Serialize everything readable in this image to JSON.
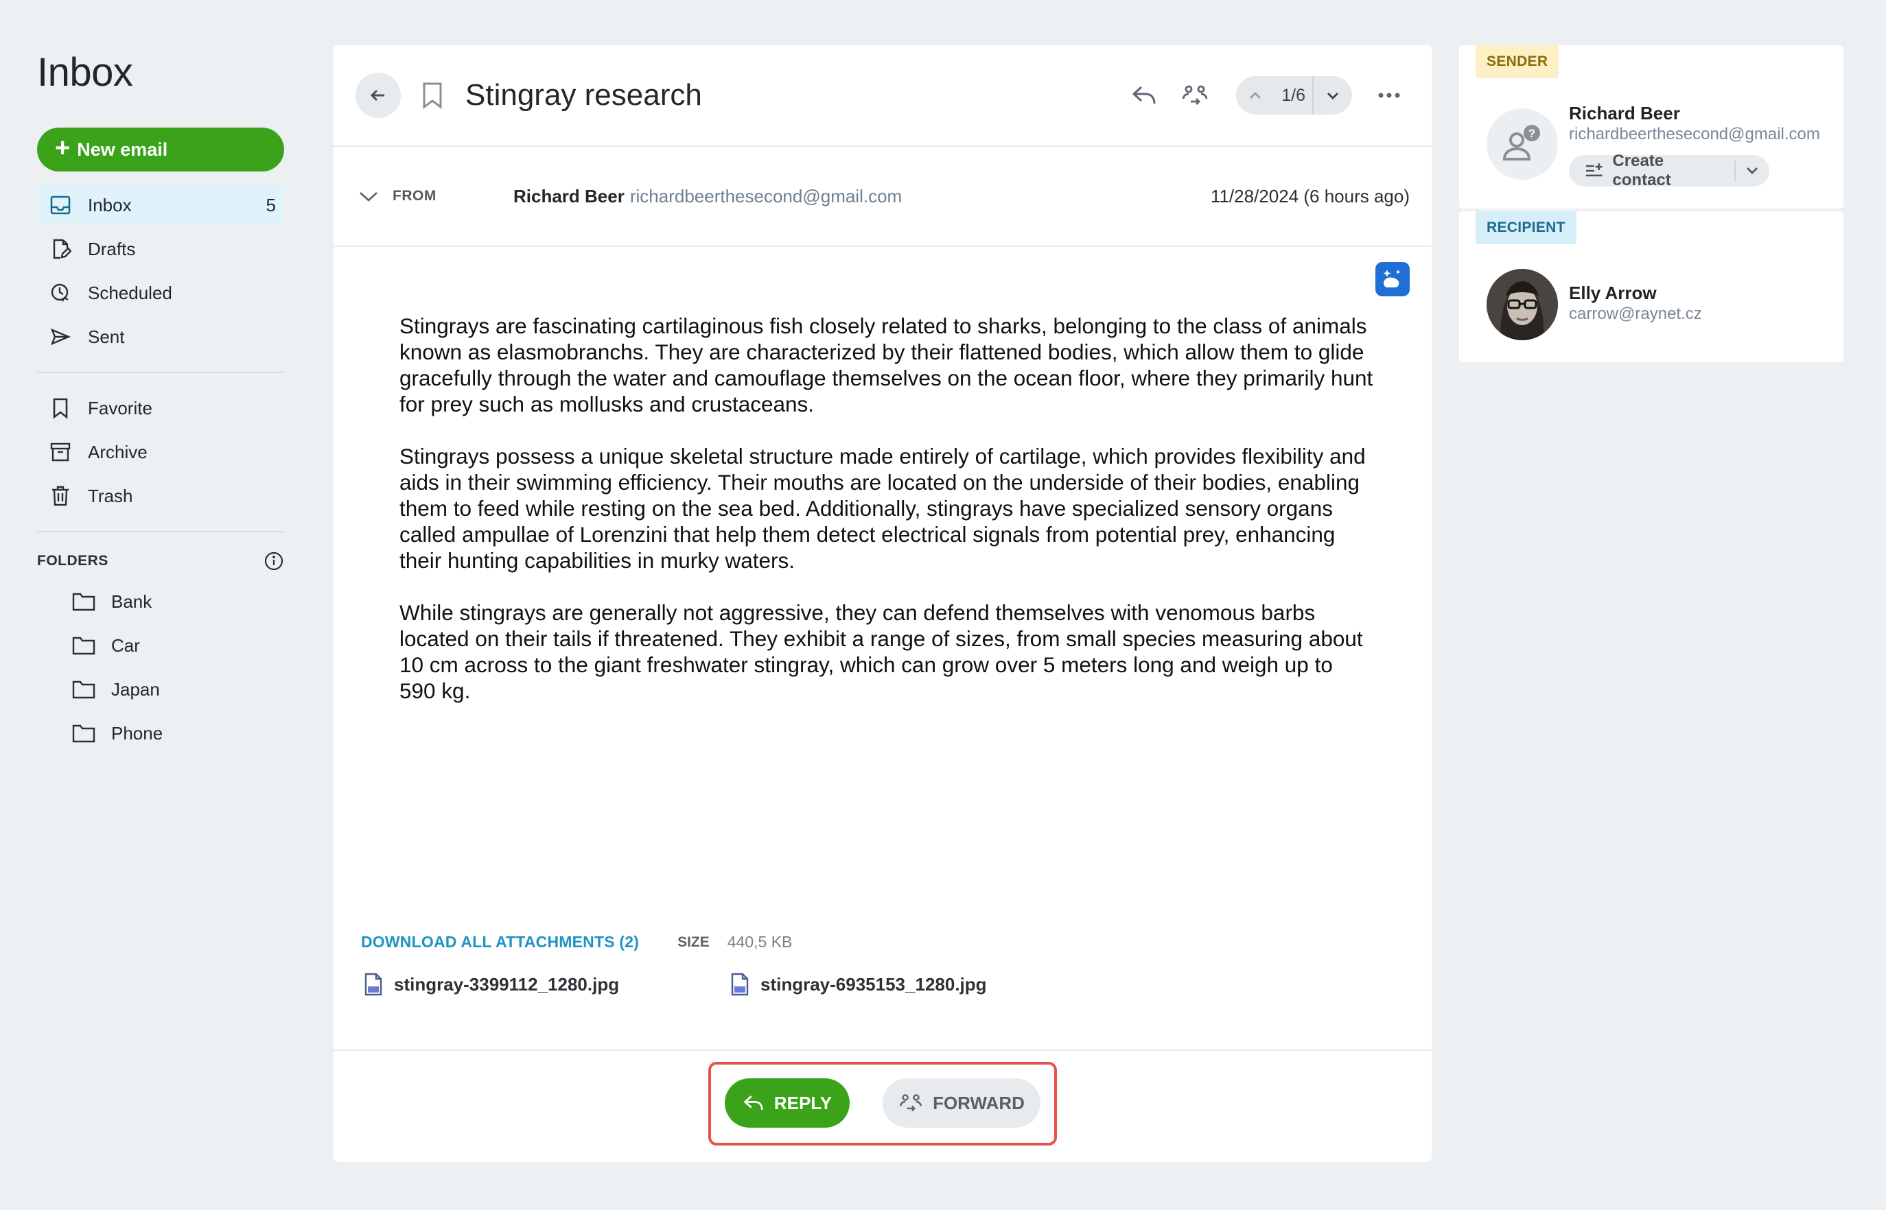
{
  "sidebar": {
    "title": "Inbox",
    "new_email_label": "New email",
    "items": [
      {
        "label": "Inbox",
        "count": "5",
        "icon": "inbox-icon"
      },
      {
        "label": "Drafts",
        "icon": "drafts-icon"
      },
      {
        "label": "Scheduled",
        "icon": "scheduled-icon"
      },
      {
        "label": "Sent",
        "icon": "sent-icon"
      }
    ],
    "items2": [
      {
        "label": "Favorite",
        "icon": "bookmark-icon"
      },
      {
        "label": "Archive",
        "icon": "archive-icon"
      },
      {
        "label": "Trash",
        "icon": "trash-icon"
      }
    ],
    "folders_heading": "FOLDERS",
    "folders": [
      {
        "label": "Bank"
      },
      {
        "label": "Car"
      },
      {
        "label": "Japan"
      },
      {
        "label": "Phone"
      }
    ]
  },
  "email": {
    "subject": "Stingray research",
    "pager": "1/6",
    "from_label": "FROM",
    "from_name": "Richard Beer",
    "from_email": "richardbeerthesecond@gmail.com",
    "date": "11/28/2024 (6 hours ago)",
    "paragraphs": [
      "Stingrays are fascinating cartilaginous fish closely related to sharks, belonging to the class of animals known as elasmobranchs. They are characterized by their flattened bodies, which allow them to glide gracefully through the water and camouflage themselves on the ocean floor, where they primarily hunt for prey such as mollusks and crustaceans.",
      "Stingrays possess a unique skeletal structure made entirely of cartilage, which provides flexibility and aids in their swimming efficiency. Their mouths are located on the underside of their bodies, enabling them to feed while resting on the sea bed. Additionally, stingrays have specialized sensory organs called ampullae of Lorenzini that help them detect electrical signals from potential prey, enhancing their hunting capabilities in murky waters.",
      "While stingrays are generally not aggressive, they can defend themselves with venomous barbs located on their tails if threatened. They exhibit a range of sizes, from small species measuring about 10 cm across to the giant freshwater stingray, which can grow over 5 meters long and weigh up to 590 kg."
    ],
    "attachments_label": "DOWNLOAD ALL ATTACHMENTS (2)",
    "size_label": "SIZE",
    "size_value": "440,5 KB",
    "files": [
      {
        "name": "stingray-3399112_1280.jpg"
      },
      {
        "name": "stingray-6935153_1280.jpg"
      }
    ],
    "reply_label": "REPLY",
    "forward_label": "FORWARD"
  },
  "sender_card": {
    "tag": "SENDER",
    "name": "Richard Beer",
    "email": "richardbeerthesecond@gmail.com",
    "create_contact_label": "Create contact"
  },
  "recipient_card": {
    "tag": "RECIPIENT",
    "name": "Elly Arrow",
    "email": "carrow@raynet.cz"
  },
  "colors": {
    "accent_green": "#3aa31a",
    "link_blue": "#1e93c4",
    "highlight_red": "#e4534b",
    "background": "#edf0f3"
  }
}
